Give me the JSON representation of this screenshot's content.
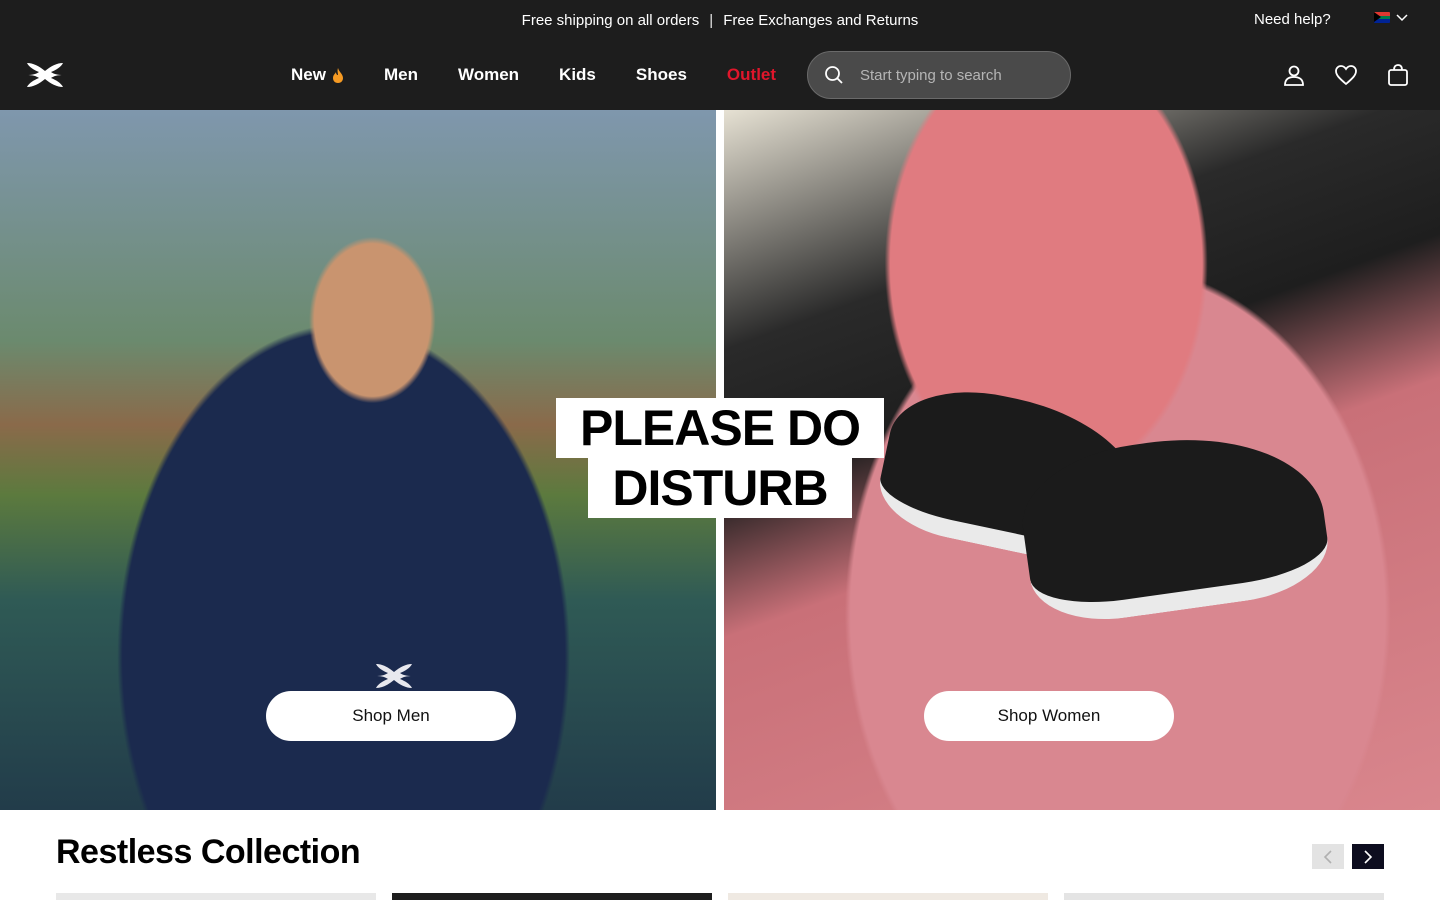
{
  "promo": {
    "shipping": "Free shipping on all orders",
    "separator": "|",
    "returns": "Free Exchanges and Returns",
    "help": "Need help?",
    "country_flag": "south-africa-flag"
  },
  "nav": {
    "logo": "under-armour-logo",
    "items": [
      {
        "label": "New",
        "icon": "flame-icon",
        "color": "#ffffff"
      },
      {
        "label": "Men",
        "color": "#ffffff"
      },
      {
        "label": "Women",
        "color": "#ffffff"
      },
      {
        "label": "Kids",
        "color": "#ffffff"
      },
      {
        "label": "Shoes",
        "color": "#ffffff"
      },
      {
        "label": "Outlet",
        "color": "#e0162b"
      }
    ],
    "search_placeholder": "Start typing to search",
    "icons": [
      "account-icon",
      "wishlist-heart-icon",
      "shopping-bag-icon"
    ]
  },
  "hero": {
    "title_line1": "PLEASE DO",
    "title_line2": "DISTURB",
    "shop_men": "Shop Men",
    "shop_women": "Shop Women"
  },
  "collection": {
    "title": "Restless Collection"
  },
  "colors": {
    "header_bg": "#1d1d1d",
    "accent_outlet": "#e0162b",
    "next_arrow_bg": "#0d0d1f"
  }
}
